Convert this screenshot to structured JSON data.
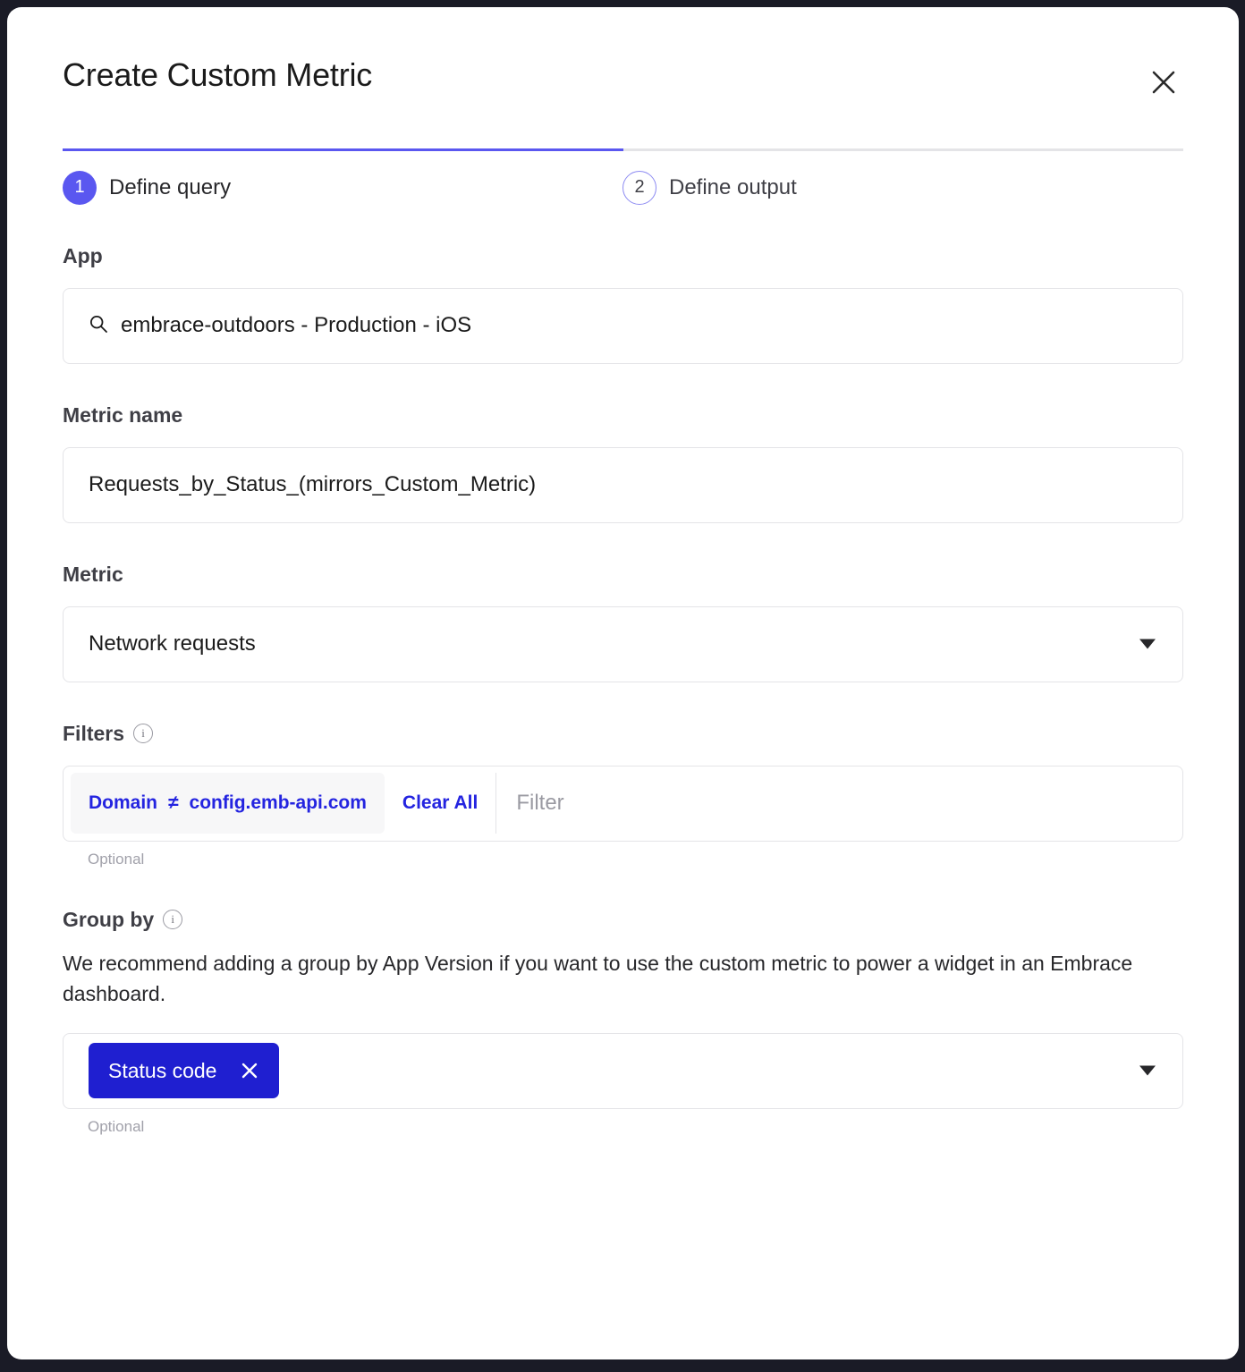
{
  "dialog": {
    "title": "Create Custom Metric",
    "close_icon": "close-icon"
  },
  "stepper": {
    "progress_percent": 50,
    "steps": [
      {
        "number": "1",
        "label": "Define query",
        "active": true
      },
      {
        "number": "2",
        "label": "Define output",
        "active": false
      }
    ]
  },
  "app": {
    "label": "App",
    "search_icon": "search-icon",
    "value": "embrace-outdoors - Production - iOS"
  },
  "metric_name": {
    "label": "Metric name",
    "value": "Requests_by_Status_(mirrors_Custom_Metric)",
    "placeholder": "Metric name"
  },
  "metric": {
    "label": "Metric",
    "value": "Network requests",
    "caret_icon": "chevron-down-icon"
  },
  "filters": {
    "label": "Filters",
    "info_icon": "info-icon",
    "info_glyph": "i",
    "chips": [
      {
        "field": "Domain",
        "operator": "≠",
        "value": "config.emb-api.com"
      }
    ],
    "clear_all_label": "Clear All",
    "placeholder": "Filter",
    "optional_label": "Optional"
  },
  "group_by": {
    "label": "Group by",
    "info_icon": "info-icon",
    "info_glyph": "i",
    "helper_text": "We recommend adding a group by App Version if you want to use the custom metric to power a widget in an Embrace dashboard.",
    "tags": [
      {
        "label": "Status code",
        "remove_icon": "close-icon"
      }
    ],
    "caret_icon": "chevron-down-icon",
    "optional_label": "Optional"
  },
  "colors": {
    "accent_purple": "#5a57f0",
    "chip_blue": "#1f1fd0",
    "link_blue": "#2424e0",
    "backdrop": "#1a1b26",
    "border": "#e4e4e7"
  }
}
